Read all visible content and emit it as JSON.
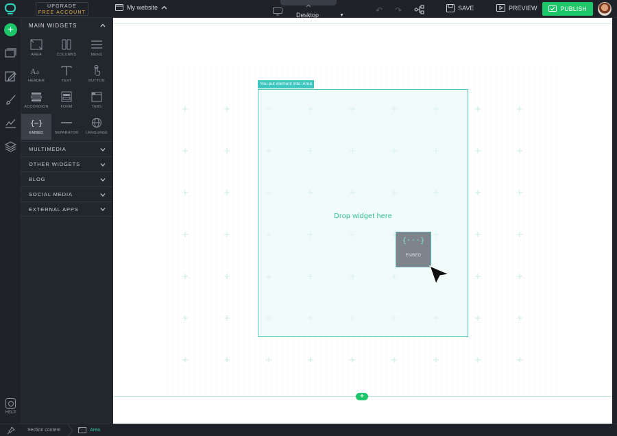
{
  "topbar": {
    "upgrade_line1": "UPGRADE",
    "upgrade_line2": "FREE ACCOUNT",
    "site_name": "My website",
    "device": "Desktop",
    "save_label": "SAVE",
    "preview_label": "PREVIEW",
    "publish_label": "PUBLISH"
  },
  "rail": {
    "help_label": "HELP"
  },
  "panel": {
    "main_title": "MAIN WIDGETS",
    "widgets": [
      {
        "label": "AREA",
        "icon": "area-icon"
      },
      {
        "label": "COLUMNS",
        "icon": "columns-icon"
      },
      {
        "label": "MENU",
        "icon": "menu-icon"
      },
      {
        "label": "HEADER",
        "icon": "header-icon"
      },
      {
        "label": "TEXT",
        "icon": "text-icon"
      },
      {
        "label": "BUTTON",
        "icon": "button-icon"
      },
      {
        "label": "ACCORDION",
        "icon": "accordion-icon"
      },
      {
        "label": "FORM",
        "icon": "form-icon"
      },
      {
        "label": "TABS",
        "icon": "tabs-icon"
      },
      {
        "label": "EMBED",
        "icon": "embed-icon"
      },
      {
        "label": "SEPARATOR",
        "icon": "separator-icon"
      },
      {
        "label": "LANGUAGE",
        "icon": "language-icon"
      }
    ],
    "sections": [
      "MULTIMEDIA",
      "OTHER WIDGETS",
      "BLOG",
      "SOCIAL MEDIA",
      "EXTERNAL APPS"
    ]
  },
  "canvas": {
    "area_tag": "You put element into: Area",
    "drop_text": "Drop widget here",
    "dragging_label": "EMBED",
    "dragging_icon": "{···}"
  },
  "bottombar": {
    "crumb_section": "Section content",
    "crumb_area": "Area"
  },
  "colors": {
    "accent_green": "#1ec66a",
    "teal": "#3ec6c1",
    "upgrade_gold": "#e6b34a",
    "dark_bg": "#1f2228"
  }
}
